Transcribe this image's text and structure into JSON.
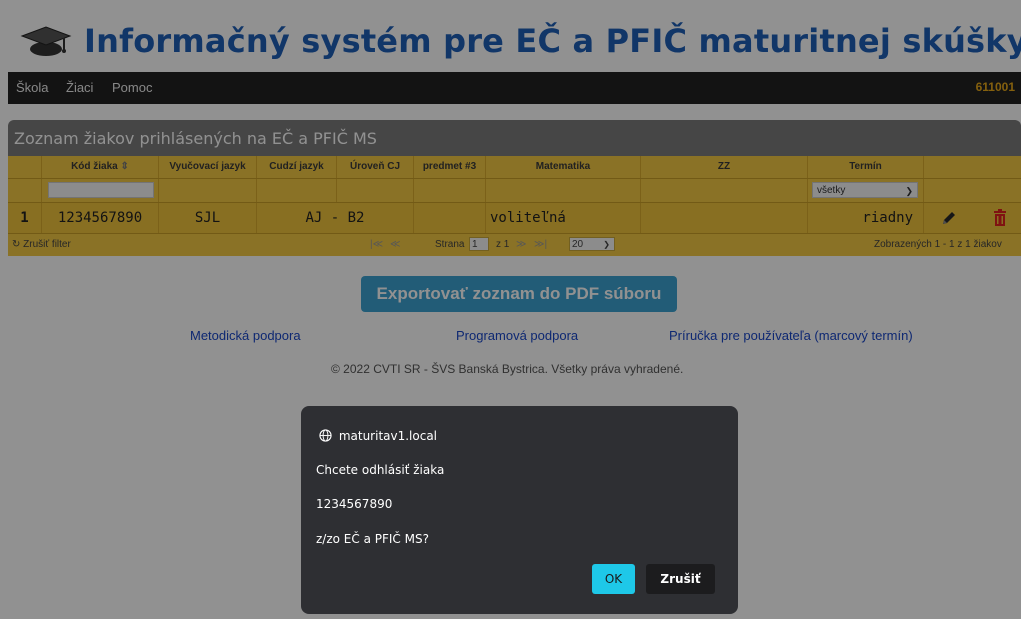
{
  "app": {
    "title": "Informačný systém pre EČ a PFIČ maturitnej skúšky",
    "logo_icon": "graduation-cap-icon"
  },
  "nav": {
    "items": [
      "Škola",
      "Žiaci",
      "Pomoc"
    ],
    "school_code": "611001"
  },
  "grid": {
    "caption": "Zoznam žiakov prihlásených na EČ a PFIČ MS",
    "columns": [
      "",
      "Kód žiaka",
      "Vyučovací jazyk",
      "Cudzí jazyk",
      "Úroveň CJ",
      "predmet #3",
      "Matematika",
      "ZZ",
      "Termín",
      ""
    ],
    "sort_icon": "sort-arrows-icon",
    "filter": {
      "code_value": "",
      "term_selected": "všetky"
    },
    "rows": [
      {
        "num": "1",
        "code": "1234567890",
        "language": "SJL",
        "foreign_language": "AJ - B2",
        "subject3": "",
        "math": "voliteľná",
        "zz": "",
        "term": "riadny",
        "edit_icon": "pencil-icon",
        "delete_icon": "trash-icon"
      }
    ],
    "pager": {
      "clear_filter": "Zrušiť filter",
      "clear_icon": "refresh-icon",
      "page_label": "Strana",
      "page_value": "1",
      "of_label": "z 1",
      "page_size": "20",
      "summary": "Zobrazených 1 - 1 z 1 žiakov"
    }
  },
  "actions": {
    "export_label": "Exportovať zoznam do PDF súboru"
  },
  "footer": {
    "links": [
      "Metodická podpora",
      "Programová podpora",
      "Príručka pre používateľa (marcový termín)"
    ],
    "copyright": "© 2022 CVTI SR - ŠVS Banská Bystrica. Všetky práva vyhradené."
  },
  "dialog": {
    "origin": "maturitav1.local",
    "origin_icon": "globe-icon",
    "line1": "Chcete odhlásiť žiaka",
    "line2": "1234567890",
    "line3": "z/zo  EČ a PFIČ MS?",
    "ok_label": "OK",
    "cancel_label": "Zrušiť"
  },
  "colors": {
    "title": "#1f5fb8",
    "navbar": "#222222",
    "school_code": "#e9a91a",
    "grid_header": "#f2c843",
    "export_button": "#3da3d1",
    "dialog_bg": "#2e2f33",
    "ok_button": "#1ec8e8",
    "delete_icon": "#e02020"
  }
}
